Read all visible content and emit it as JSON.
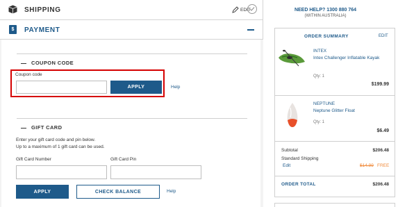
{
  "shipping": {
    "title": "SHIPPING",
    "edit_label": "EDIT"
  },
  "payment": {
    "title": "PAYMENT",
    "card_glyph": "$",
    "coupon": {
      "heading": "COUPON CODE",
      "field_label": "Coupon code",
      "value": "",
      "apply_label": "APPLY",
      "help_label": "Help"
    },
    "gift_card": {
      "heading": "GIFT CARD",
      "desc_line1": "Enter your gift card code and pin below.",
      "desc_line2": "Up to a maximum of 1 gift card can be used.",
      "number_label": "Gift Card Number",
      "number_value": "",
      "pin_label": "Gift Card Pin",
      "pin_value": "",
      "apply_label": "APPLY",
      "check_balance_label": "CHECK BALANCE",
      "help_label": "Help"
    }
  },
  "help_box": {
    "line1": "NEED HELP? 1300 880 764",
    "line2": "(WITHIN AUSTRALIA)"
  },
  "order_summary": {
    "title": "ORDER SUMMARY",
    "edit_label": "EDIT",
    "items": [
      {
        "brand": "INTEX",
        "name": "Intex Challenger Inflatable Kayak",
        "qty": "Qty: 1",
        "price": "$199.99",
        "icon": "kayak-icon"
      },
      {
        "brand": "NEPTUNE",
        "name": "Neptune Glitter Float",
        "qty": "Qty: 1",
        "price": "$6.49",
        "icon": "float-icon"
      }
    ],
    "subtotal_label": "Subtotal",
    "subtotal_value": "$206.48",
    "shipping_label": "Standard Shipping",
    "shipping_edit": "Edit",
    "shipping_old": "$14.99",
    "shipping_new": "FREE",
    "total_label": "ORDER TOTAL",
    "total_value": "$206.48"
  },
  "colors": {
    "brand": "#1e5a8a",
    "highlight": "#d50000",
    "promo": "#f08a3a"
  }
}
